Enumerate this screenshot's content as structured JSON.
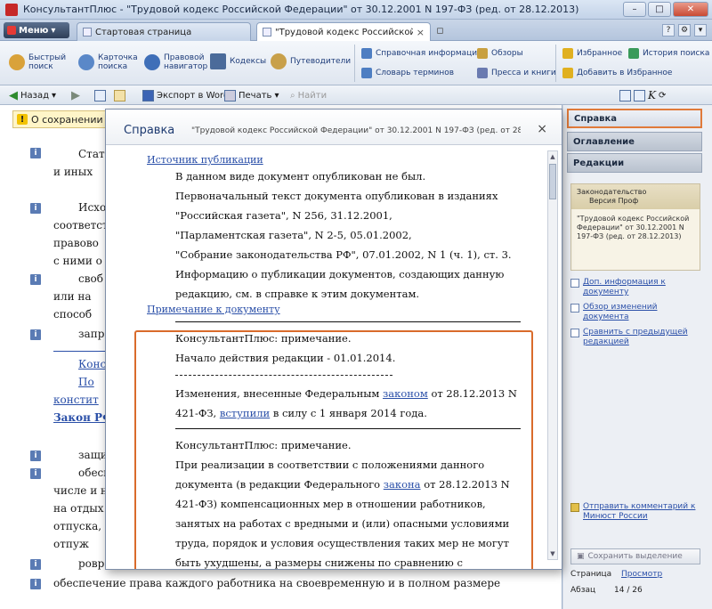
{
  "window": {
    "title": "КонсультантПлюс - \"Трудовой кодекс Российской Федерации\" от 30.12.2001 N 197-ФЗ (ред. от 28.12.2013)"
  },
  "tabs": {
    "menu_label": "Меню",
    "items": [
      {
        "label": "Стартовая страница"
      },
      {
        "label": "\"Трудовой кодекс Российской Фед..."
      }
    ]
  },
  "ribbon": {
    "buttons": [
      {
        "label": "Быстрый поиск",
        "color": "#d9a23a"
      },
      {
        "label": "Карточка поиска",
        "color": "#5a88c8"
      },
      {
        "label": "Правовой навигатор",
        "color": "#3f6fb8"
      },
      {
        "label": "Кодексы",
        "color": "#4b6b9a"
      },
      {
        "label": "Путеводители",
        "color": "#c8a04a"
      }
    ],
    "small": [
      {
        "label": "Справочная информация",
        "color": "#4e7ec2"
      },
      {
        "label": "Обзоры",
        "color": "#c8a040"
      },
      {
        "label": "Избранное",
        "color": "#e0b020"
      },
      {
        "label": "История поиска",
        "color": "#3a9a5a"
      },
      {
        "label": "Словарь терминов",
        "color": "#4e7ec2"
      },
      {
        "label": "Пресса и книги",
        "color": "#6a7ab0"
      },
      {
        "label": "Добавить в Избранное",
        "color": "#e0b020"
      }
    ]
  },
  "toolbar": {
    "back": "Назад",
    "export": "Экспорт в Word",
    "print": "Печать",
    "find": "Найти"
  },
  "document": {
    "banner": "О сохранении",
    "lines": [
      "Стат",
      "и иных",
      "Исхо",
      "соответст",
      "правово",
      "с ними о",
      "своб",
      "или на",
      "способ",
      "запре",
      "Конс",
      "По",
      "констит",
      "Закон РФ",
      "защи",
      "обесп",
      "числе и на",
      "на отдых",
      "отпуска,",
      "отпуж",
      "ровр",
      "обеспечение права каждого работника на своевременную и в полном размере"
    ]
  },
  "dialog": {
    "title": "Справка",
    "subtitle": "\"Трудовой кодекс Российской Федерации\" от 30.12.2001 N 197-ФЗ (ред. от 28.12.20...",
    "close": "×",
    "source_title": "Источник публикации",
    "source_lines": [
      "В данном виде документ опубликован не был.",
      "Первоначальный текст документа опубликован в изданиях",
      "\"Российская газета\", N 256, 31.12.2001,",
      "\"Парламентская газета\", N 2-5, 05.01.2002,",
      "\"Собрание законодательства РФ\", 07.01.2002, N 1 (ч. 1), ст. 3.",
      "Информацию о публикации документов, создающих данную",
      "редакцию, см. в справке к этим документам."
    ],
    "note_title": "Примечание к документу",
    "note1_head": "КонсультантПлюс: примечание.",
    "note1_body": "Начало действия редакции - 01.01.2014.",
    "changes_a": "Изменения, внесенные Федеральным",
    "changes_link1": "законом",
    "changes_b": "от 28.12.2013 N",
    "changes_c": "421-ФЗ,",
    "changes_link2": "вступили",
    "changes_d": "в силу с 1 января 2014 года.",
    "note2_head": "КонсультантПлюс: примечание.",
    "note2_l1": "При реализации в соответствии с положениями данного",
    "note2_l2a": "документа (в редакции Федерального",
    "note2_l2link": "закона",
    "note2_l2b": "от 28.12.2013 N",
    "note2_l3": "421-ФЗ) компенсационных мер в отношении работников,",
    "note2_l4": "занятых на работах с вредными и (или) опасными условиями",
    "note2_l5": "труда, порядок и условия осуществления таких мер не могут",
    "note2_l6": "быть ухудшены, а размеры снижены по сравнению с"
  },
  "right_panel": {
    "tabs": [
      "Справка",
      "Оглавление",
      "Редакции"
    ],
    "box_head_l1": "Законодательство",
    "box_head_l2": "Версия Проф",
    "box_l1": "\"Трудовой кодекс Российской",
    "box_l2": "Федерации\" от 30.12.2001 N",
    "box_l3": "197-ФЗ (ред. от 28.12.2013)",
    "links": [
      {
        "label": "Доп. информация к документу"
      },
      {
        "label": "Обзор изменений документа"
      },
      {
        "label": "Сравнить с предыдущей редакцией"
      },
      {
        "label": "Отправить комментарий к Минюст России"
      }
    ],
    "button": "Сохранить выделение",
    "footer_l1_label": "Страница",
    "footer_l1_value": "Просмотр",
    "footer_l2_label": "Абзац",
    "footer_l2_value": "14 / 26"
  }
}
